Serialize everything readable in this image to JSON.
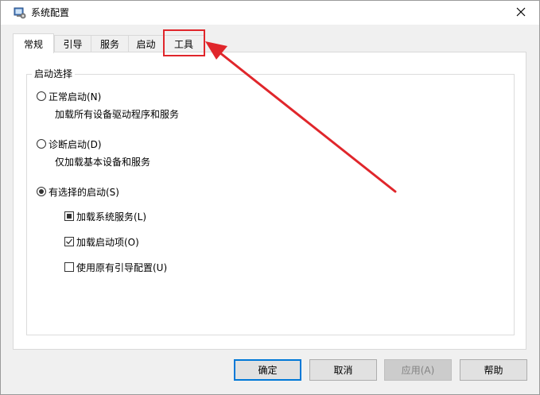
{
  "window": {
    "title": "系统配置"
  },
  "tabs": [
    {
      "label": "常规",
      "active": true
    },
    {
      "label": "引导",
      "active": false
    },
    {
      "label": "服务",
      "active": false
    },
    {
      "label": "启动",
      "active": false
    },
    {
      "label": "工具",
      "active": false,
      "highlighted": true
    }
  ],
  "startup_selection": {
    "group_label": "启动选择",
    "options": [
      {
        "label": "正常启动(N)",
        "description": "加载所有设备驱动程序和服务",
        "selected": false
      },
      {
        "label": "诊断启动(D)",
        "description": "仅加载基本设备和服务",
        "selected": false
      },
      {
        "label": "有选择的启动(S)",
        "selected": true
      }
    ],
    "selective_items": [
      {
        "label": "加载系统服务(L)",
        "state": "indeterminate"
      },
      {
        "label": "加载启动项(O)",
        "state": "checked"
      },
      {
        "label": "使用原有引导配置(U)",
        "state": "unchecked"
      }
    ]
  },
  "buttons": {
    "ok": "确定",
    "cancel": "取消",
    "apply": "应用(A)",
    "help": "帮助"
  },
  "colors": {
    "annotation": "#e0262b",
    "default_button_border": "#0078d7",
    "window_bg": "#f0f0f0"
  }
}
